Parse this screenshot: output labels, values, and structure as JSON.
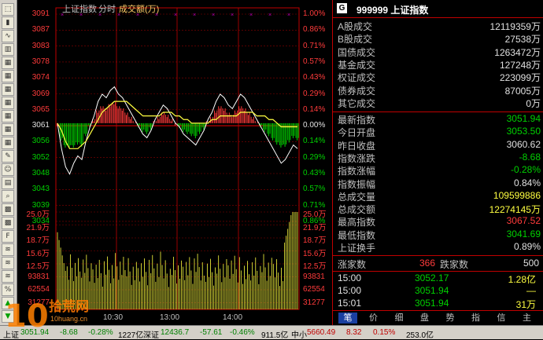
{
  "toolbar": {
    "icons": [
      "select-icon",
      "kline-icon",
      "trend-icon",
      "bar-icon",
      "calendar-icon",
      "calendar-icon",
      "calendar-icon",
      "calendar-icon",
      "calendar-icon",
      "calendar-icon",
      "calendar-icon",
      "tool-icon",
      "user-icon",
      "news-icon",
      "zoom-icon",
      "grid-icon",
      "grid-icon",
      "f10-icon",
      "chart-icon",
      "chart-icon",
      "chart-icon",
      "percent-icon",
      "up-icon",
      "down-icon"
    ]
  },
  "chart": {
    "title": "上证指数",
    "mode": "分时",
    "indicator": "成交额(万)",
    "price_left": [
      "3091",
      "3087",
      "3083",
      "3078",
      "3074",
      "3069",
      "3065",
      "3061",
      "3056",
      "3052",
      "3048",
      "3043",
      "3039",
      "3034"
    ],
    "price_right": [
      "1.00%",
      "0.86%",
      "0.71%",
      "0.57%",
      "0.43%",
      "0.29%",
      "0.14%",
      "0.00%",
      "0.14%",
      "0.29%",
      "0.43%",
      "0.57%",
      "0.71%",
      "0.86%"
    ],
    "vol_labels": [
      "25.0万",
      "21.9万",
      "18.7万",
      "15.6万",
      "12.5万",
      "93831",
      "62554",
      "31277"
    ],
    "time_labels": [
      "10:30",
      "13:00",
      "14:00"
    ],
    "colors": {
      "up": "#ff3b3b",
      "down": "#00d000",
      "grid": "#8b0000",
      "price_line": "#ffffff",
      "avg_line": "#ffff40"
    }
  },
  "chart_data": {
    "type": "line",
    "price_series": [
      3061,
      3054,
      3049,
      3047,
      3050,
      3052,
      3051,
      3056,
      3060,
      3063,
      3067,
      3069,
      3068,
      3070,
      3071,
      3069,
      3068,
      3066,
      3064,
      3062,
      3060,
      3058,
      3057,
      3059,
      3062,
      3064,
      3066,
      3065,
      3063,
      3061,
      3060,
      3058,
      3057,
      3056,
      3055,
      3057,
      3059,
      3062,
      3064,
      3067,
      3069,
      3068,
      3066,
      3065,
      3067,
      3069,
      3068,
      3066,
      3064,
      3062,
      3060,
      3058,
      3056,
      3054,
      3052,
      3050,
      3051,
      3053,
      3055,
      3054
    ],
    "avg_series": [
      3061,
      3059,
      3056,
      3054,
      3054,
      3054,
      3055,
      3056,
      3058,
      3060,
      3062,
      3064,
      3065,
      3066,
      3067,
      3067,
      3067,
      3067,
      3066,
      3065,
      3064,
      3063,
      3063,
      3063,
      3063,
      3063,
      3064,
      3064,
      3064,
      3063,
      3063,
      3062,
      3062,
      3061,
      3061,
      3061,
      3061,
      3061,
      3062,
      3062,
      3063,
      3063,
      3063,
      3063,
      3063,
      3064,
      3064,
      3064,
      3064,
      3063,
      3063,
      3063,
      3062,
      3062,
      3061,
      3060,
      3060,
      3060,
      3060,
      3060
    ],
    "ylim": [
      3034,
      3091
    ],
    "vol_ylim": [
      0,
      250000
    ]
  },
  "panel": {
    "badge": "G",
    "code_name": "999999 上证指数",
    "stats": [
      {
        "label": "A股成交",
        "value": "12119359万",
        "color": "#e0e0e0"
      },
      {
        "label": "B股成交",
        "value": "27538万",
        "color": "#e0e0e0"
      },
      {
        "label": "国债成交",
        "value": "1263472万",
        "color": "#e0e0e0"
      },
      {
        "label": "基金成交",
        "value": "127248万",
        "color": "#e0e0e0"
      },
      {
        "label": "权证成交",
        "value": "223099万",
        "color": "#e0e0e0"
      },
      {
        "label": "债券成交",
        "value": "87005万",
        "color": "#e0e0e0"
      },
      {
        "label": "其它成交",
        "value": "0万",
        "color": "#e0e0e0"
      }
    ],
    "quotes": [
      {
        "label": "最新指数",
        "value": "3051.94",
        "color": "#00d000"
      },
      {
        "label": "今日开盘",
        "value": "3053.50",
        "color": "#00d000"
      },
      {
        "label": "昨日收盘",
        "value": "3060.62",
        "color": "#e0e0e0"
      },
      {
        "label": "指数涨跌",
        "value": "-8.68",
        "color": "#00d000"
      },
      {
        "label": "指数涨幅",
        "value": "-0.28%",
        "color": "#00d000"
      },
      {
        "label": "指数振幅",
        "value": "0.84%",
        "color": "#e0e0e0"
      },
      {
        "label": "总成交量",
        "value": "109599886",
        "color": "#ffff40"
      },
      {
        "label": "总成交额",
        "value": "12274145万",
        "color": "#ffff40"
      },
      {
        "label": "最高指数",
        "value": "3067.52",
        "color": "#ff3b3b"
      },
      {
        "label": "最低指数",
        "value": "3041.69",
        "color": "#00d000"
      },
      {
        "label": "上证换手",
        "value": "0.89%",
        "color": "#e0e0e0"
      }
    ],
    "updown": {
      "up_label": "涨家数",
      "up_value": "366",
      "down_label": "跌家数",
      "down_value": "500"
    },
    "ticks": [
      {
        "time": "15:00",
        "price": "3052.17",
        "vol": "1.28亿"
      },
      {
        "time": "15:00",
        "price": "3051.94",
        "vol": "—"
      },
      {
        "time": "15:01",
        "price": "3051.94",
        "vol": "31万"
      }
    ],
    "tabs": [
      "笔",
      "价",
      "细",
      "盘",
      "势",
      "指",
      "信",
      "主"
    ]
  },
  "status": {
    "sh_label": "上证",
    "sh_price": "3051.94",
    "sh_change": "-8.68",
    "sh_pct": "-0.28%",
    "sh_amount": "1227亿",
    "sz_label": "深证",
    "sz_price": "12436.7",
    "sz_change": "-57.61",
    "sz_pct": "-0.46%",
    "sz_amount": "911.5亿",
    "zx_label": "中小",
    "zx_price": "5660.49",
    "zx_change": "8.32",
    "zx_pct": "0.15%",
    "zx_amount": "253.0亿"
  },
  "watermark": {
    "big": "10",
    "text": "拾荒网",
    "url": "10huang.cn"
  }
}
